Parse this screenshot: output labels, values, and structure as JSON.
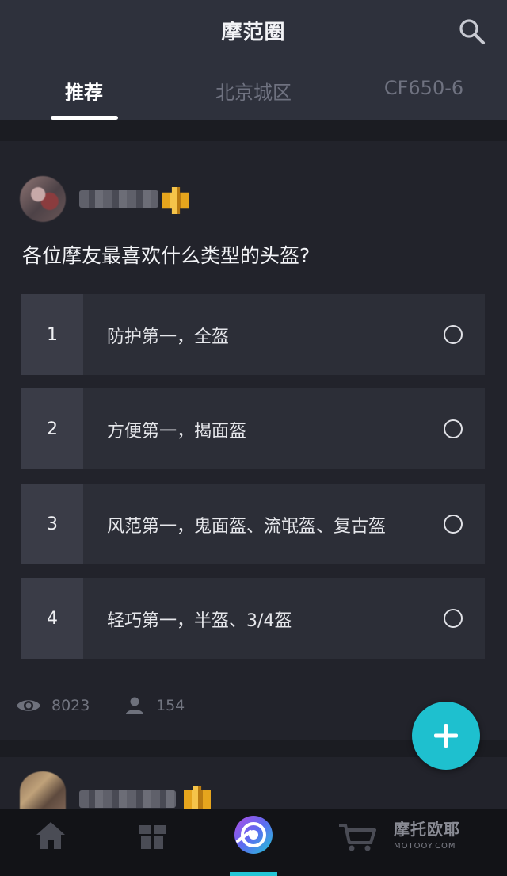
{
  "header": {
    "title": "摩范圈",
    "tabs": [
      {
        "label": "推荐",
        "active": true
      },
      {
        "label": "北京城区",
        "active": false
      },
      {
        "label": "CF650-6",
        "active": false
      }
    ],
    "search_icon": "search-icon"
  },
  "post": {
    "question": "各位摩友最喜欢什么类型的头盔?",
    "options": [
      {
        "number": "1",
        "text": "防护第一，全盔"
      },
      {
        "number": "2",
        "text": "方便第一，揭面盔"
      },
      {
        "number": "3",
        "text": "风范第一，鬼面盔、流氓盔、复古盔"
      },
      {
        "number": "4",
        "text": "轻巧第一，半盔、3/4盔"
      }
    ],
    "stats": {
      "views": "8023",
      "participants": "154"
    }
  },
  "fab": {
    "icon": "plus-icon"
  },
  "bottom_nav": {
    "items": [
      {
        "icon": "home-icon",
        "active": false
      },
      {
        "icon": "gift-box-icon",
        "active": false
      },
      {
        "icon": "moto-circle-icon",
        "active": true
      },
      {
        "icon": "shopping-cart-icon",
        "active": false
      }
    ],
    "watermark": {
      "text": "摩托欧耶",
      "sub": "MOTOOY.COM"
    }
  },
  "colors": {
    "accent": "#1ec0cf",
    "header_bg": "#2e313c",
    "card_bg": "#22232b",
    "option_bg": "#2c2e37",
    "badge_gold": "#e6a51d"
  }
}
